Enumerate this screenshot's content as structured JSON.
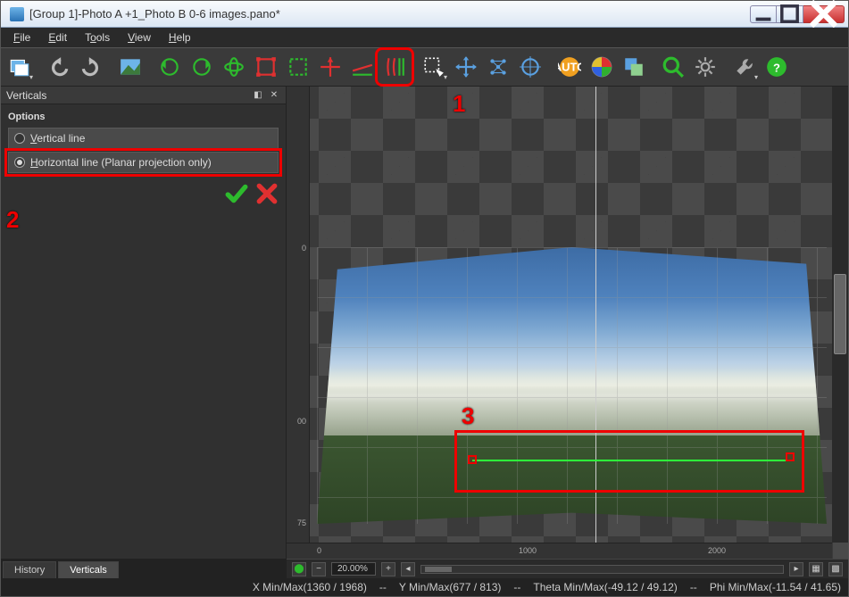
{
  "window": {
    "title": "[Group 1]-Photo A +1_Photo B 0-6 images.pano*"
  },
  "menus": {
    "file": "File",
    "edit": "Edit",
    "tools": "Tools",
    "view": "View",
    "help": "Help"
  },
  "toolbar_icons": [
    "new-project",
    "undo",
    "redo",
    "preview-sky",
    "rotate-ccw",
    "rotate-cw",
    "rotate-3d",
    "crop",
    "crop-inner",
    "center-cross",
    "level",
    "verticals-tool",
    "select-marquee",
    "move",
    "mesh",
    "target",
    "auto",
    "color-wheel",
    "layers",
    "find",
    "gear",
    "wrench",
    "help"
  ],
  "side_panel": {
    "title": "Verticals",
    "options_label": "Options",
    "opt_vertical": "Vertical line",
    "opt_horizontal": "Horizontal line (Planar projection only)",
    "tabs": {
      "history": "History",
      "verticals": "Verticals"
    }
  },
  "annotations": {
    "n1": "1",
    "n2": "2",
    "n3": "3"
  },
  "ruler": {
    "v0": "0",
    "v1": "00",
    "v2": "75",
    "h0": "0",
    "h1": "1000",
    "h2": "2000"
  },
  "viewbar": {
    "zoom": "20.00%"
  },
  "status": {
    "x": "X Min/Max(1360 / 1968)",
    "y": "Y Min/Max(677 / 813)",
    "theta": "Theta Min/Max(-49.12 / 49.12)",
    "phi": "Phi Min/Max(-11.54 / 41.65)",
    "sep": "--"
  },
  "chart_data": {
    "type": "table",
    "title": "Status readouts",
    "series": [
      {
        "name": "X Min/Max",
        "values": [
          1360,
          1968
        ]
      },
      {
        "name": "Y Min/Max",
        "values": [
          677,
          813
        ]
      },
      {
        "name": "Theta Min/Max",
        "values": [
          -49.12,
          49.12
        ]
      },
      {
        "name": "Phi Min/Max",
        "values": [
          -11.54,
          41.65
        ]
      }
    ]
  }
}
